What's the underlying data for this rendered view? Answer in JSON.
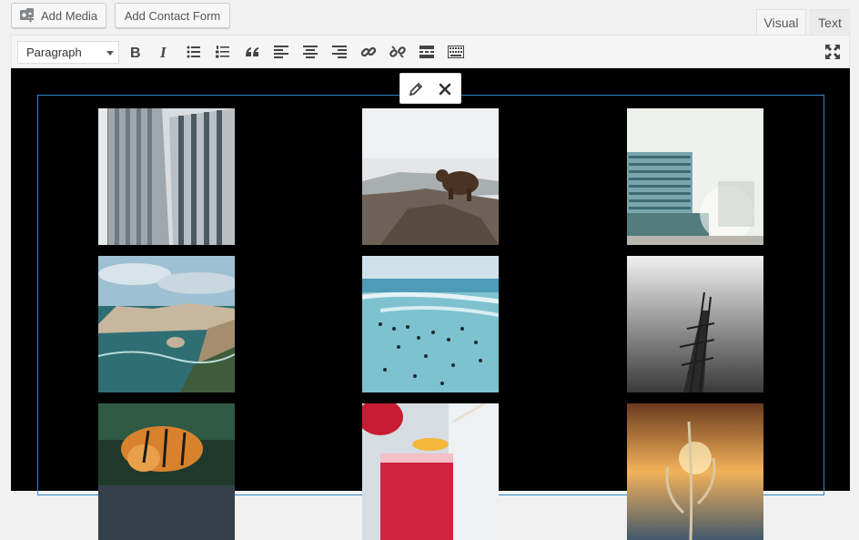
{
  "media_bar": {
    "add_media_label": "Add Media",
    "add_contact_form_label": "Add Contact Form"
  },
  "editor_tabs": [
    {
      "label": "Visual",
      "active": true
    },
    {
      "label": "Text",
      "active": false
    }
  ],
  "toolbar": {
    "format_select_value": "Paragraph",
    "buttons": [
      "bold-icon",
      "italic-icon",
      "bulleted-list-icon",
      "numbered-list-icon",
      "blockquote-icon",
      "align-left-icon",
      "align-center-icon",
      "align-right-icon",
      "link-icon",
      "unlink-icon",
      "read-more-icon",
      "toolbar-toggle-icon",
      "fullscreen-icon"
    ]
  },
  "gallery": {
    "floating_toolbar": [
      "edit-pencil-icon",
      "remove-icon"
    ],
    "selection_color": "#2f86c6",
    "images": [
      {
        "subject": "office-tower"
      },
      {
        "subject": "bear-on-rocks"
      },
      {
        "subject": "beach-building"
      },
      {
        "subject": "coastal-cliffs"
      },
      {
        "subject": "swimmers-in-sea"
      },
      {
        "subject": "ruined-pier"
      },
      {
        "subject": "tiger-drinking"
      },
      {
        "subject": "red-cocktail"
      },
      {
        "subject": "grass-at-sunset"
      }
    ]
  }
}
